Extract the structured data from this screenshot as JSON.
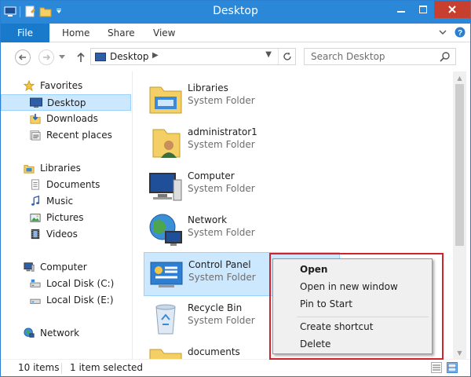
{
  "window": {
    "title": "Desktop"
  },
  "ribbon": {
    "file": "File",
    "tabs": [
      "Home",
      "Share",
      "View"
    ]
  },
  "nav": {
    "address": "Desktop",
    "search_placeholder": "Search Desktop"
  },
  "sidebar": {
    "groups": [
      {
        "label": "Favorites",
        "icon": "star-icon",
        "items": [
          {
            "label": "Desktop",
            "icon": "desktop-icon",
            "selected": true
          },
          {
            "label": "Downloads",
            "icon": "downloads-icon"
          },
          {
            "label": "Recent places",
            "icon": "recent-places-icon"
          }
        ]
      },
      {
        "label": "Libraries",
        "icon": "libraries-icon",
        "items": [
          {
            "label": "Documents",
            "icon": "documents-icon"
          },
          {
            "label": "Music",
            "icon": "music-icon"
          },
          {
            "label": "Pictures",
            "icon": "pictures-icon"
          },
          {
            "label": "Videos",
            "icon": "videos-icon"
          }
        ]
      },
      {
        "label": "Computer",
        "icon": "computer-icon",
        "items": [
          {
            "label": "Local Disk (C:)",
            "icon": "disk-icon"
          },
          {
            "label": "Local Disk (E:)",
            "icon": "disk-icon"
          }
        ]
      },
      {
        "label": "Network",
        "icon": "network-icon",
        "items": []
      }
    ]
  },
  "content": {
    "items": [
      {
        "name": "Libraries",
        "type": "System Folder",
        "icon": "libraries-folder-icon"
      },
      {
        "name": "administrator1",
        "type": "System Folder",
        "icon": "user-folder-icon"
      },
      {
        "name": "Computer",
        "type": "System Folder",
        "icon": "computer-icon"
      },
      {
        "name": "Network",
        "type": "System Folder",
        "icon": "network-globe-icon"
      },
      {
        "name": "Control Panel",
        "type": "System Folder",
        "icon": "control-panel-icon",
        "selected": true
      },
      {
        "name": "Recycle Bin",
        "type": "System Folder",
        "icon": "recycle-bin-icon"
      },
      {
        "name": "documents",
        "type": "",
        "icon": "folder-icon"
      }
    ]
  },
  "context_menu": {
    "items": [
      "Open",
      "Open in new window",
      "Pin to Start",
      "Create shortcut",
      "Delete"
    ]
  },
  "status": {
    "count": "10 items",
    "selected": "1 item selected"
  },
  "colors": {
    "titlebar": "#2b88d9",
    "file_tab": "#1979ca",
    "selection": "#cce8ff",
    "highlight": "#d2232a"
  }
}
